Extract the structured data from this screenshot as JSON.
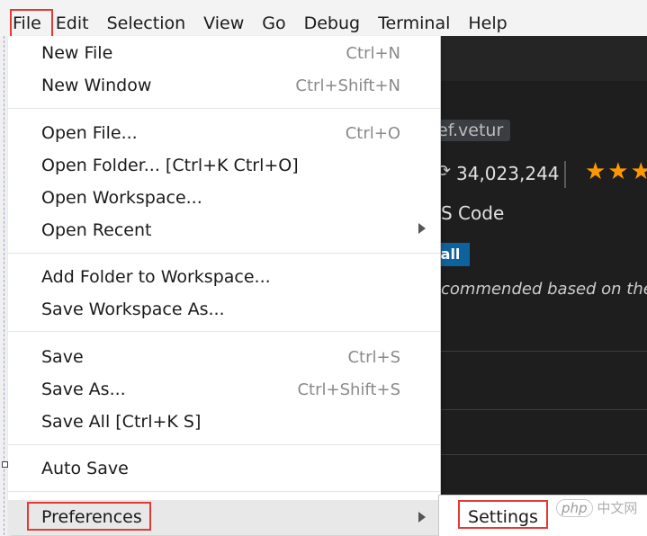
{
  "menubar": {
    "items": [
      "File",
      "Edit",
      "Selection",
      "View",
      "Go",
      "Debug",
      "Terminal",
      "Help"
    ]
  },
  "file_menu": {
    "new_file": {
      "label": "New File",
      "shortcut": "Ctrl+N"
    },
    "new_window": {
      "label": "New Window",
      "shortcut": "Ctrl+Shift+N"
    },
    "open_file": {
      "label": "Open File...",
      "shortcut": "Ctrl+O"
    },
    "open_folder": {
      "label": "Open Folder... [Ctrl+K Ctrl+O]"
    },
    "open_workspace": {
      "label": "Open Workspace..."
    },
    "open_recent": {
      "label": "Open Recent"
    },
    "add_folder": {
      "label": "Add Folder to Workspace..."
    },
    "save_workspace_as": {
      "label": "Save Workspace As..."
    },
    "save": {
      "label": "Save",
      "shortcut": "Ctrl+S"
    },
    "save_as": {
      "label": "Save As...",
      "shortcut": "Ctrl+Shift+S"
    },
    "save_all": {
      "label": "Save All [Ctrl+K S]"
    },
    "auto_save": {
      "label": "Auto Save"
    },
    "preferences": {
      "label": "Preferences"
    }
  },
  "submenu": {
    "settings": "Settings"
  },
  "extension_panel": {
    "identifier": "ef.vetur",
    "downloads": "34,023,244",
    "rating_stars": "★★★",
    "publisher_text": "S Code",
    "install_label": "tall",
    "recommendation": "commended based on the f"
  },
  "watermark": {
    "badge": "php",
    "text": "中文网"
  },
  "colors": {
    "highlight_box": "#e53935",
    "install_button": "#0e639c",
    "stars": "#ff9800",
    "editor_bg": "#1e1e1e"
  }
}
